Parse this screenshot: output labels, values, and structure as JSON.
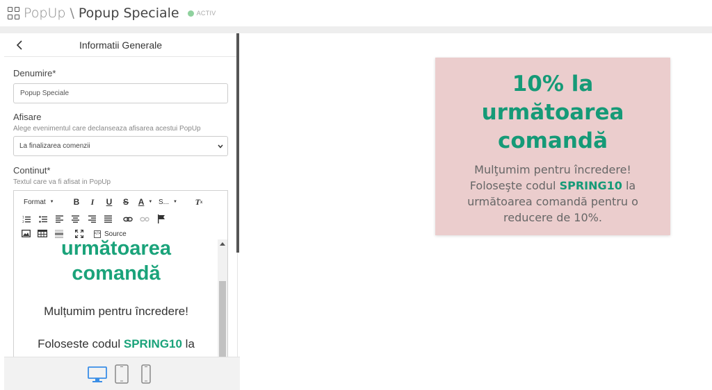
{
  "header": {
    "root_label": "PopUp",
    "separator": "\\",
    "title": "Popup Speciale",
    "status": "ACTIV",
    "status_color": "#8fd19e"
  },
  "panel": {
    "title": "Informatii Generale",
    "denumire": {
      "label": "Denumire*",
      "value": "Popup Speciale"
    },
    "afisare": {
      "label": "Afisare",
      "hint": "Alege evenimentul care declanseaza afisarea acestui PopUp",
      "selected": "La finalizarea comenzii"
    },
    "continut": {
      "label": "Continut*",
      "hint": "Textul care va fi afisat in PopUp"
    }
  },
  "editor": {
    "toolbar": {
      "format_label": "Format",
      "size_label": "S...",
      "bold": "B",
      "italic": "I",
      "underline": "U",
      "strike": "S",
      "color": "A",
      "source_label": "Source"
    },
    "body": {
      "heading_line1": "următoarea",
      "heading_line2": "comandă",
      "para1": "Mulțumim pentru încredere!",
      "para2_prefix": "Foloseste codul ",
      "para2_code": "SPRING10",
      "para2_suffix": " la"
    }
  },
  "devices": [
    "desktop-icon",
    "tablet-icon",
    "phone-icon"
  ],
  "preview": {
    "heading_line1": "10% la",
    "heading_line2": "următoarea",
    "heading_line3": "comandă",
    "para1": "Mulţumim pentru încredere!",
    "para2_prefix": "Foloseşte codul ",
    "code": "SPRING10",
    "para2_suffix": " la următoarea comandă pentru o reducere de 10%.",
    "background": "#ebcdcd",
    "accent": "#159a77"
  }
}
